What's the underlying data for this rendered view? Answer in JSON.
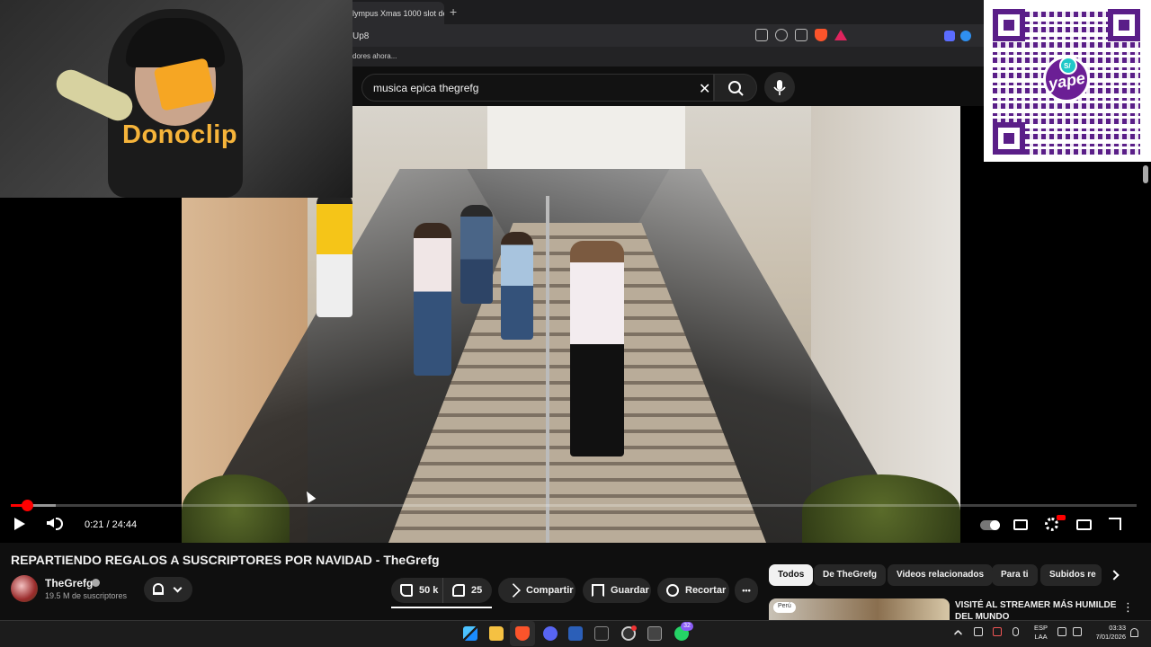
{
  "browser": {
    "tab_title": "lympus Xmas 1000 slot de",
    "new_tab": "+",
    "url_fragment": "Up8",
    "bookmark": "dores ahora..."
  },
  "search": {
    "query": "musica epica thegrefg",
    "clear_icon": "close-icon",
    "search_icon": "search-icon",
    "mic_icon": "microphone-icon"
  },
  "overlay": {
    "donoclip_label": "Donoclip",
    "qr_brand": "yape",
    "qr_badge": "S/"
  },
  "player": {
    "current_time": "0:21",
    "duration": "24:44",
    "time_display": "0:21 / 24:44",
    "progress_played": 0.014,
    "progress_buffered": 0.04
  },
  "video": {
    "title": "REPARTIENDO REGALOS A SUSCRIPTORES POR NAVIDAD - TheGrefg",
    "channel": "TheGrefg",
    "subscribers": "19.5 M de suscriptores",
    "likes": "50 k",
    "dislikes": "25",
    "share_label": "Compartir",
    "save_label": "Guardar",
    "clip_label": "Recortar",
    "more_label": "•••"
  },
  "chips": [
    "Todos",
    "De TheGrefg",
    "Videos relacionados",
    "Para ti",
    "Subidos re"
  ],
  "recommendation": {
    "tag": "Perú",
    "title": "VISITÉ AL STREAMER MÁS HUMILDE DEL MUNDO",
    "more": "⋮"
  },
  "taskbar": {
    "whatsapp_badge": "32",
    "lang_line1": "ESP",
    "lang_line2": "LAA",
    "time": "03:33",
    "date": "7/01/2026"
  },
  "colors": {
    "accent_red": "#ff0000",
    "background": "#0f0f0f",
    "chip_bg": "#272727",
    "qr_purple": "#5a1e88",
    "donoclip_orange": "#f6b43a"
  }
}
